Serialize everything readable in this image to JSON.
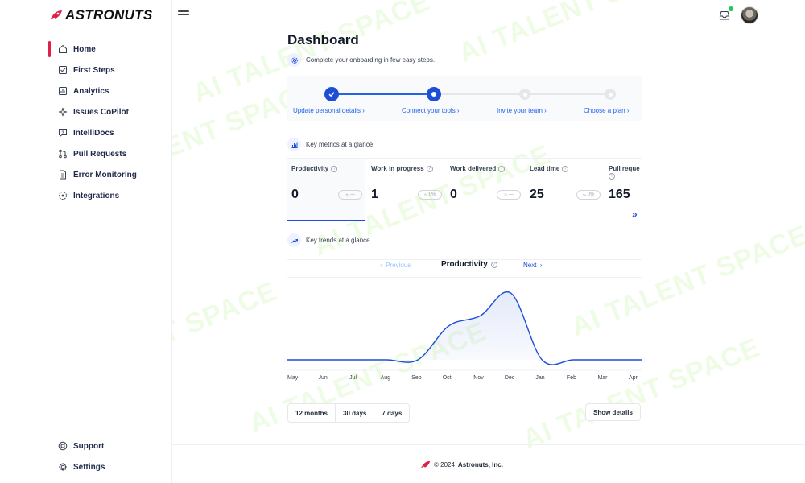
{
  "app": {
    "brand": "ASTRONUTS"
  },
  "sidebar": {
    "items": [
      {
        "label": "Home",
        "icon": "home-icon",
        "active": true
      },
      {
        "label": "First Steps",
        "icon": "checklist-icon"
      },
      {
        "label": "Analytics",
        "icon": "bar-chart-icon"
      },
      {
        "label": "Issues CoPilot",
        "icon": "sparkle-icon"
      },
      {
        "label": "IntelliDocs",
        "icon": "chat-question-icon"
      },
      {
        "label": "Pull Requests",
        "icon": "pull-request-icon"
      },
      {
        "label": "Error Monitoring",
        "icon": "document-icon"
      },
      {
        "label": "Integrations",
        "icon": "integrations-icon"
      }
    ],
    "bottom_items": [
      {
        "label": "Support",
        "icon": "lifebuoy-icon"
      },
      {
        "label": "Settings",
        "icon": "gear-icon"
      }
    ]
  },
  "dashboard": {
    "title": "Dashboard",
    "onboarding_text": "Complete your onboarding in few easy steps.",
    "steps": [
      {
        "label": "Update personal details",
        "state": "done"
      },
      {
        "label": "Connect your tools",
        "state": "current"
      },
      {
        "label": "Invite your team",
        "state": "todo"
      },
      {
        "label": "Choose a plan",
        "state": "todo"
      }
    ],
    "metrics_heading": "Key metrics at a glance.",
    "metrics": [
      {
        "label": "Productivity",
        "value": "0",
        "trend": "—"
      },
      {
        "label": "Work in progress",
        "value": "1",
        "trend": "0%"
      },
      {
        "label": "Work delivered",
        "value": "0",
        "trend": "—"
      },
      {
        "label": "Lead time",
        "value": "25",
        "trend": "0%"
      },
      {
        "label": "Pull reque",
        "value": "165",
        "trend": ""
      }
    ],
    "more_symbol": "»",
    "trends_heading": "Key trends at a glance.",
    "chart_nav": {
      "previous": "Previous",
      "title": "Productivity",
      "next": "Next"
    },
    "range_buttons": [
      "12 months",
      "30 days",
      "7 days"
    ],
    "details_button": "Show details"
  },
  "chart_data": {
    "type": "area",
    "categories": [
      "May",
      "Jun",
      "Jul",
      "Aug",
      "Sep",
      "Oct",
      "Nov",
      "Dec",
      "Jan",
      "Feb",
      "Mar",
      "Apr"
    ],
    "values": [
      0,
      0,
      0,
      0,
      0,
      4.5,
      5.8,
      8.8,
      0,
      0,
      0,
      0
    ],
    "ylim": [
      0,
      10
    ],
    "grid": false,
    "color": "#1d4ed8"
  },
  "footer": {
    "text_prefix": "© 2024",
    "company": "Astronuts, Inc."
  },
  "watermark": {
    "text": "AI TALENT SPACE"
  }
}
